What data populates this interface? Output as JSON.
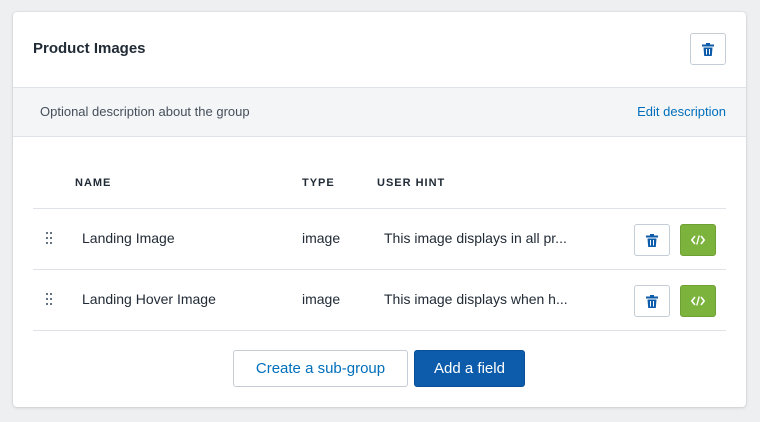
{
  "card": {
    "title": "Product Images",
    "description": "Optional description about the group",
    "edit_description_label": "Edit description"
  },
  "table": {
    "columns": [
      "NAME",
      "TYPE",
      "USER HINT"
    ],
    "rows": [
      {
        "name": "Landing Image",
        "type": "image",
        "hint": "This image displays in all pr..."
      },
      {
        "name": "Landing Hover Image",
        "type": "image",
        "hint": "This image displays when h..."
      }
    ]
  },
  "actions": {
    "create_subgroup_label": "Create a sub-group",
    "add_field_label": "Add a field"
  },
  "colors": {
    "primary": "#0d5cab",
    "link": "#006fbb",
    "code_button": "#7bb33c",
    "description_bg": "#f4f5f7"
  },
  "icons": [
    "trash-icon",
    "code-icon",
    "drag-handle-icon"
  ]
}
